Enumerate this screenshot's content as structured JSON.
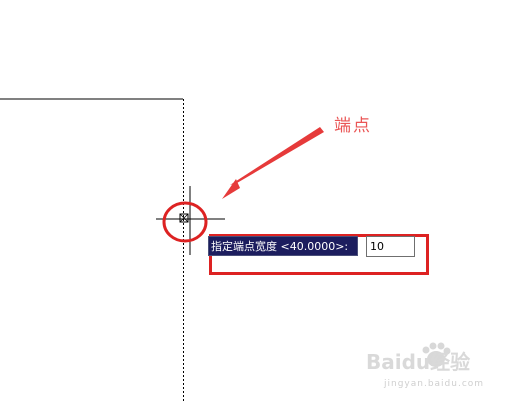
{
  "annotation": {
    "label": "端点",
    "color": "#ea5555"
  },
  "command_prompt": {
    "text": "指定端点宽度 <40.0000>:",
    "input_value": "10",
    "background_color": "#1c1d5e"
  },
  "highlight_color": "#dd2222",
  "watermark": {
    "text": "Baidu经验",
    "subtext": "jingyan.baidu.com"
  }
}
